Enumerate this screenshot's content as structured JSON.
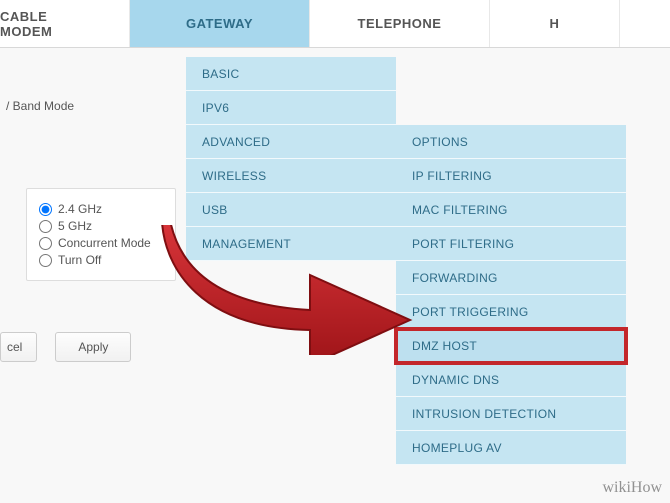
{
  "topnav": {
    "tabs": [
      "CABLE MODEM",
      "GATEWAY",
      "TELEPHONE",
      "H"
    ],
    "active_index": 1
  },
  "page_label": "/ Band Mode",
  "menu1": [
    "BASIC",
    "IPV6",
    "ADVANCED",
    "WIRELESS",
    "USB",
    "MANAGEMENT"
  ],
  "menu2": [
    "OPTIONS",
    "IP FILTERING",
    "MAC FILTERING",
    "PORT FILTERING",
    "FORWARDING",
    "PORT TRIGGERING",
    "DMZ HOST",
    "DYNAMIC DNS",
    "INTRUSION DETECTION",
    "HOMEPLUG AV"
  ],
  "menu2_highlight_index": 6,
  "radio_options": [
    {
      "label": "2.4 GHz",
      "checked": true
    },
    {
      "label": "5 GHz",
      "checked": false
    },
    {
      "label": "Concurrent Mode",
      "checked": false
    },
    {
      "label": "Turn Off",
      "checked": false
    }
  ],
  "buttons": {
    "cancel": "cel",
    "apply": "Apply"
  },
  "watermark": {
    "prefix": "wiki",
    "suffix": "How"
  },
  "colors": {
    "highlight": "#c3272b",
    "menu_bg": "#c5e5f2",
    "tab_active": "#a7d7ed",
    "arrow": "#bd1e22"
  }
}
